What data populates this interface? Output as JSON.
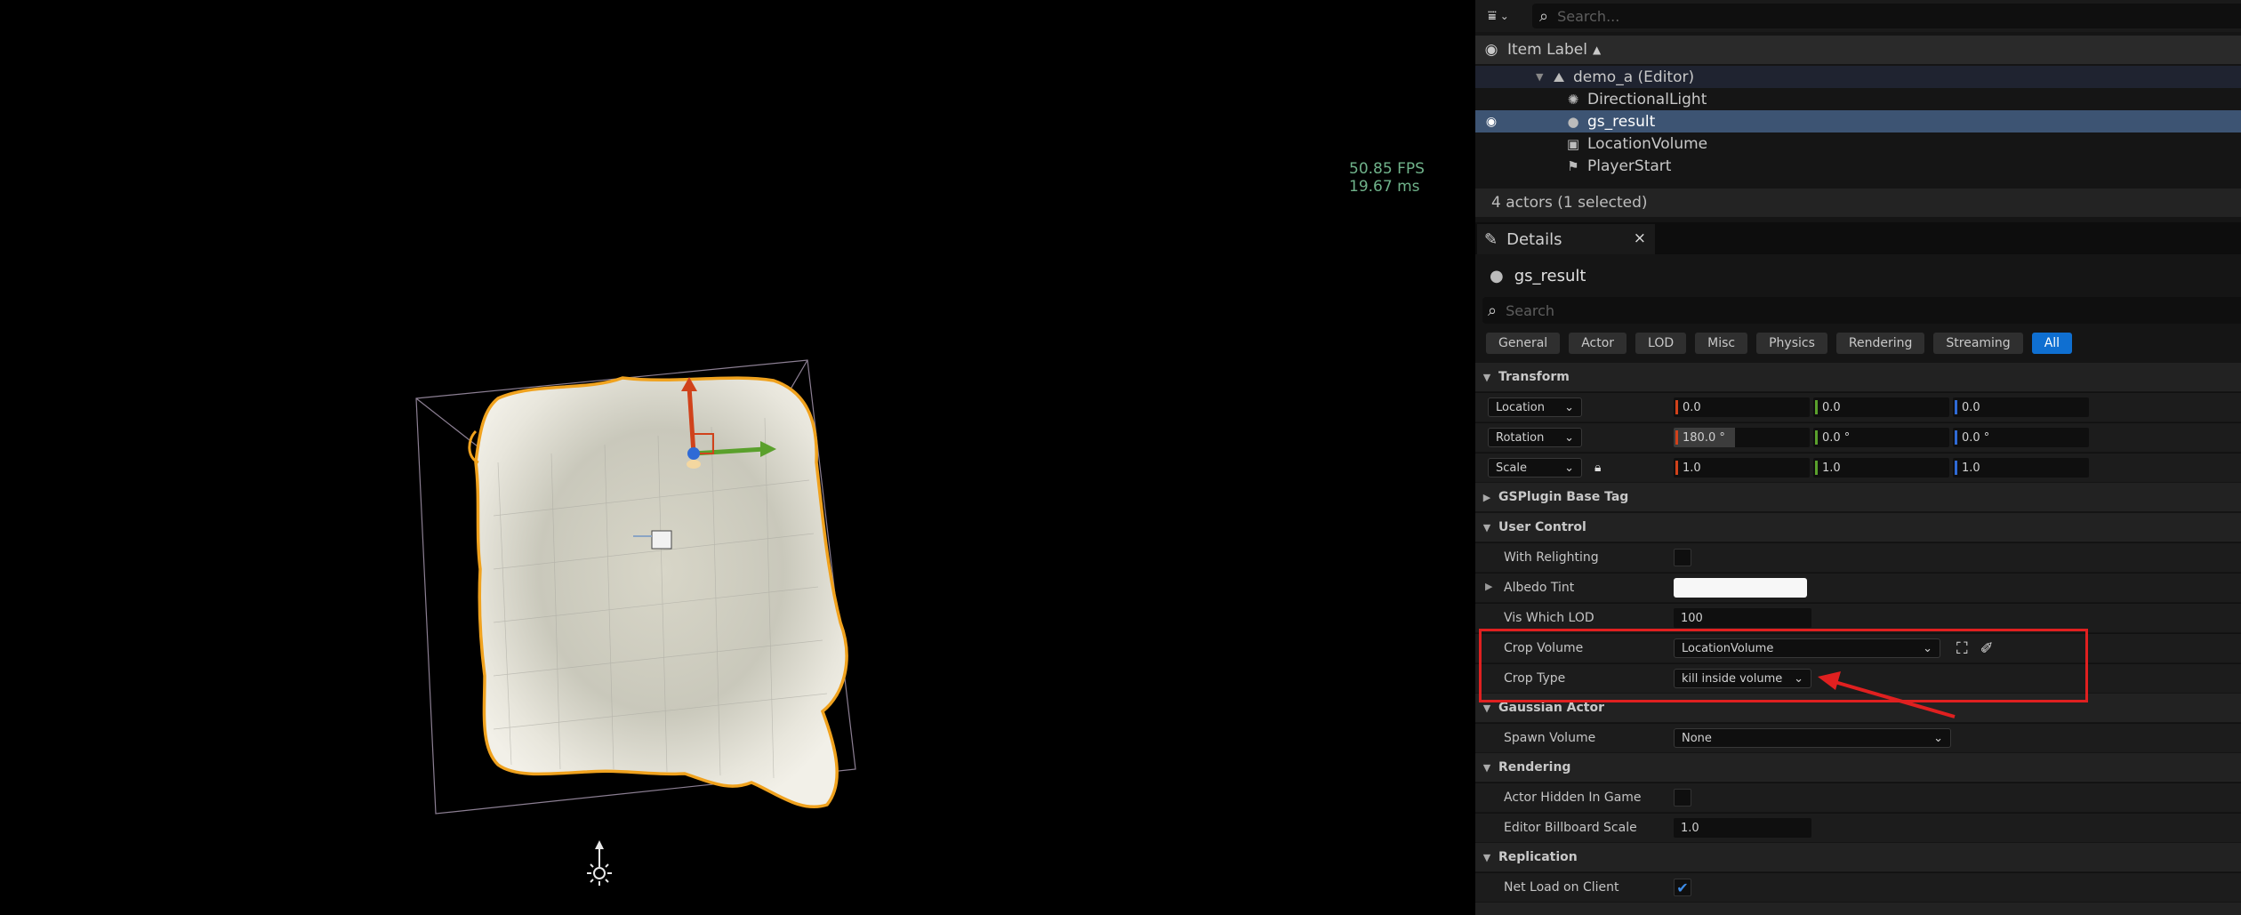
{
  "viewport": {
    "fps": "50.85 FPS",
    "ms": "19.67 ms"
  },
  "outliner": {
    "search_placeholder": "Search...",
    "column_label": "Item Label",
    "sort_icon": "sort-ascending-icon",
    "world": "demo_a (Editor)",
    "items": [
      {
        "label": "DirectionalLight",
        "icon": "directional-light-icon"
      },
      {
        "label": "gs_result",
        "icon": "actor-sphere-icon"
      },
      {
        "label": "LocationVolume",
        "icon": "volume-icon"
      },
      {
        "label": "PlayerStart",
        "icon": "player-start-icon"
      }
    ],
    "actor_count": "4 actors (1 selected)"
  },
  "details": {
    "tab_label": "Details",
    "close": "×",
    "actor_name": "gs_result",
    "search_placeholder": "Search",
    "filters": [
      "General",
      "Actor",
      "LOD",
      "Misc",
      "Physics",
      "Rendering",
      "Streaming",
      "All"
    ],
    "active_filter": "All",
    "sections": {
      "transform": "Transform",
      "gsplugin": "GSPlugin Base Tag",
      "user_control": "User Control",
      "gaussian_actor": "Gaussian Actor",
      "rendering": "Rendering",
      "replication": "Replication"
    },
    "transform": {
      "location_label": "Location",
      "location": [
        "0.0",
        "0.0",
        "0.0"
      ],
      "rotation_label": "Rotation",
      "rotation": [
        "180.0 °",
        "0.0 °",
        "0.0 °"
      ],
      "scale_label": "Scale",
      "scale": [
        "1.0",
        "1.0",
        "1.0"
      ]
    },
    "user_control": {
      "with_relighting": "With Relighting",
      "albedo_tint": "Albedo Tint",
      "albedo_tint_color": "#f7f7f7",
      "vis_which_lod": "Vis Which LOD",
      "vis_which_lod_value": "100",
      "crop_volume": "Crop Volume",
      "crop_volume_value": "LocationVolume",
      "crop_type": "Crop Type",
      "crop_type_value": "kill inside volume"
    },
    "gaussian_actor": {
      "spawn_volume": "Spawn Volume",
      "spawn_volume_value": "None"
    },
    "rendering": {
      "actor_hidden": "Actor Hidden In Game",
      "billboard_scale": "Editor Billboard Scale",
      "billboard_scale_value": "1.0"
    },
    "replication": {
      "net_load": "Net Load on Client"
    }
  },
  "colors": {
    "accent": "#0f6fd1",
    "highlight": "#e02020",
    "x_axis": "#d0421b",
    "y_axis": "#5aa02c",
    "z_axis": "#2f6ad6"
  }
}
